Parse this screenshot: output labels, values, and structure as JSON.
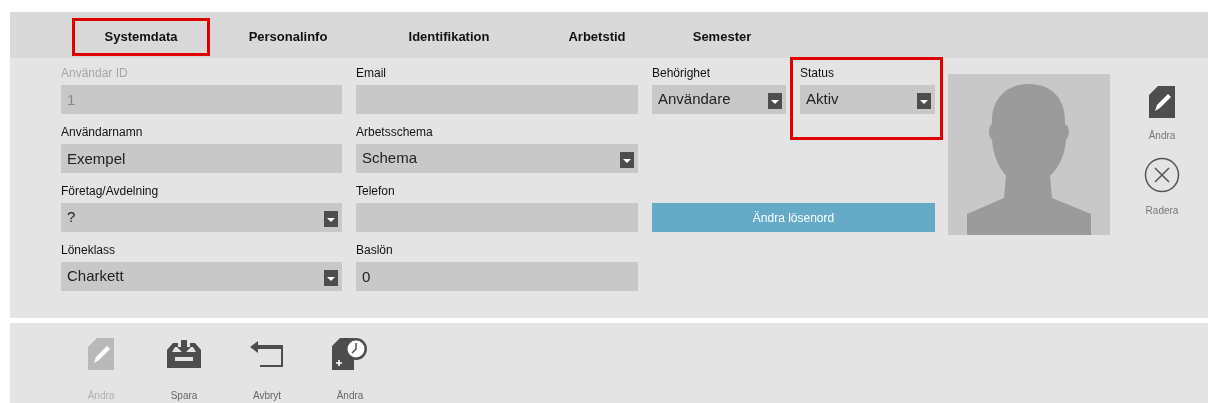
{
  "tabs": [
    {
      "label": "Systemdata",
      "selected": true
    },
    {
      "label": "Personalinfo",
      "selected": false
    },
    {
      "label": "Identifikation",
      "selected": false
    },
    {
      "label": "Arbetstid",
      "selected": false
    },
    {
      "label": "Semester",
      "selected": false
    }
  ],
  "form_rows": [
    [
      {
        "kind": "text",
        "label": "Användar ID",
        "value": "1",
        "disabled": true
      },
      {
        "kind": "text",
        "label": "Email"
      },
      {
        "kind": "select",
        "label": "Behörighet",
        "value": "Användare"
      },
      {
        "kind": "select",
        "label": "Status",
        "value": "Aktiv",
        "highlighted": true
      }
    ],
    [
      {
        "kind": "text",
        "label": "Användarnamn",
        "value": "Exempel"
      },
      {
        "kind": "select",
        "label": "Arbetsschema",
        "value": "Schema"
      }
    ],
    [
      {
        "kind": "select",
        "label": "Företag/Avdelning",
        "value": "?"
      },
      {
        "kind": "text",
        "label": "Telefon"
      },
      {
        "kind": "button",
        "value": "Ändra lösenord"
      }
    ],
    [
      {
        "kind": "select",
        "label": "Löneklass",
        "value": "Charkett"
      },
      {
        "kind": "text",
        "label": "Baslön",
        "value": "0"
      }
    ]
  ],
  "side_actions": [
    {
      "kind": "edit",
      "label": "Ändra"
    },
    {
      "kind": "delete",
      "label": "Radera"
    }
  ],
  "toolbar": [
    {
      "kind": "edit",
      "label": "Ändra",
      "disabled": true
    },
    {
      "kind": "save",
      "label": "Spara",
      "disabled": false
    },
    {
      "kind": "cancel",
      "label": "Avbryt",
      "disabled": false
    },
    {
      "kind": "schedule",
      "label": "Ändra",
      "disabled": false
    }
  ]
}
